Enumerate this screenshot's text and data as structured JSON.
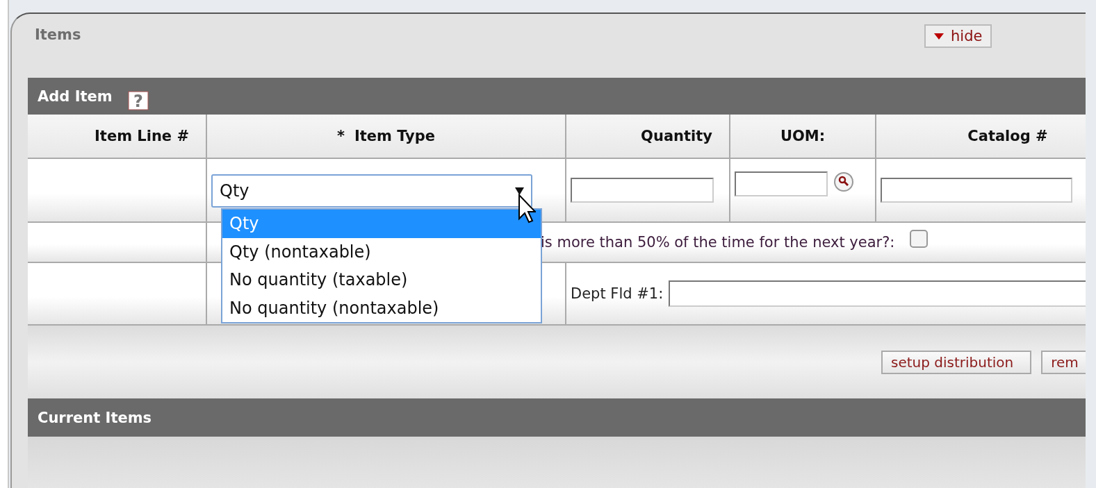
{
  "panel": {
    "title": "Items",
    "hide_button": {
      "label": "hide"
    }
  },
  "add_item": {
    "title": "Add Item",
    "help_label": "?",
    "columns": [
      {
        "label": "Item Line #"
      },
      {
        "label": "Item Type",
        "required_mark": "*"
      },
      {
        "label": "Quantity"
      },
      {
        "label": "UOM:"
      },
      {
        "label": "Catalog #"
      }
    ],
    "item_type": {
      "value": "Qty",
      "expanded": true,
      "options": [
        {
          "label": "Qty",
          "selected": true
        },
        {
          "label": "Qty (nontaxable)",
          "selected": false
        },
        {
          "label": "No quantity (taxable)",
          "selected": false
        },
        {
          "label": "No quantity (nontaxable)",
          "selected": false
        }
      ]
    },
    "question": {
      "text": "is more than 50% of the time for the next year?:",
      "checked": false
    },
    "dept_field": {
      "label": "Dept Fld #1:"
    },
    "buttons": [
      "setup distribution",
      "rem"
    ]
  },
  "current_items": {
    "title": "Current Items"
  }
}
